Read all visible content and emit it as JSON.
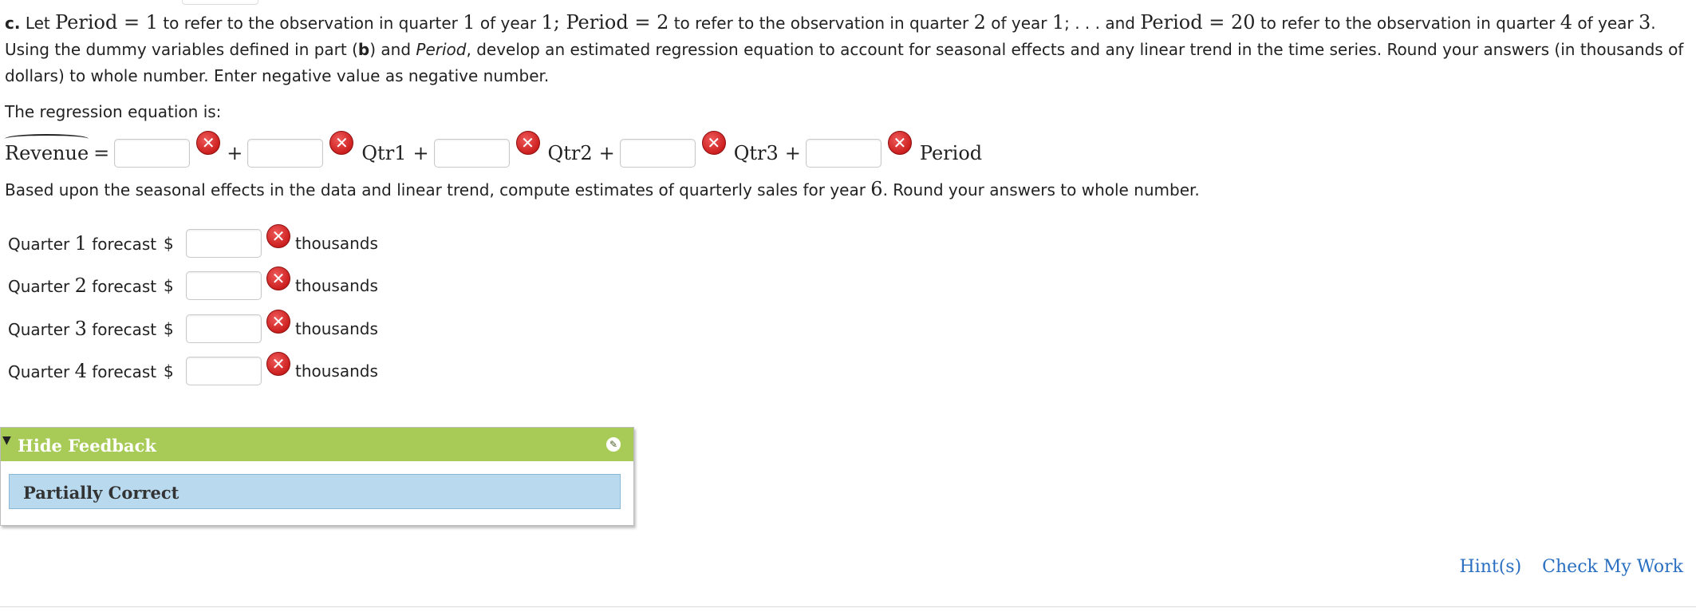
{
  "question": {
    "part_label": "c.",
    "t1": "Let ",
    "m_period": "Period",
    "m_eq1": " = 1",
    "t2": " to refer to the observation in quarter ",
    "m1": "1",
    "t3": " of year ",
    "m1b": "1",
    "t4": "; ",
    "m_eq2": " = 2",
    "m2": "2",
    "t5": "; . . . and ",
    "m_eq20": " = 20",
    "m4": "4",
    "m3": "3",
    "t6": ". Using the dummy variables defined in part (",
    "part_b": "b",
    "t7": ") and ",
    "period_italic": "Period",
    "t8": ", develop an estimated regression equation to account for seasonal effects and any linear trend in the time series. Round your answers (in thousands of dollars) to whole number. Enter negative value as negative number."
  },
  "regression": {
    "prompt": "The regression equation is:",
    "lhs": "Revenue",
    "eq_sign": "=",
    "plus": "+",
    "terms": [
      "",
      "Qtr1",
      "Qtr2",
      "Qtr3",
      "Period"
    ],
    "values": [
      "",
      "",
      "",
      "",
      ""
    ],
    "mark_icon": "✕"
  },
  "forecast": {
    "instruction_a": "Based upon the seasonal effects in the data and linear trend, compute estimates of quarterly sales for year ",
    "year_num": "6",
    "instruction_b": ". Round your answers to whole number.",
    "rows": [
      {
        "label_a": "Quarter ",
        "num": "1",
        "label_b": " forecast",
        "currency": "$",
        "value": "",
        "units": "thousands"
      },
      {
        "label_a": "Quarter ",
        "num": "2",
        "label_b": " forecast",
        "currency": "$",
        "value": "",
        "units": "thousands"
      },
      {
        "label_a": "Quarter ",
        "num": "3",
        "label_b": " forecast",
        "currency": "$",
        "value": "",
        "units": "thousands"
      },
      {
        "label_a": "Quarter ",
        "num": "4",
        "label_b": " forecast",
        "currency": "$",
        "value": "",
        "units": "thousands"
      }
    ]
  },
  "feedback": {
    "toggle_icon": "▼",
    "title": "Hide Feedback",
    "status": "Partially Correct",
    "edit_icon": "✎",
    "header_color": "#a8cb58",
    "status_bg": "#b9daee"
  },
  "links": {
    "hints": "Hint(s)",
    "check": "Check My Work",
    "color": "#2a6fc2"
  }
}
